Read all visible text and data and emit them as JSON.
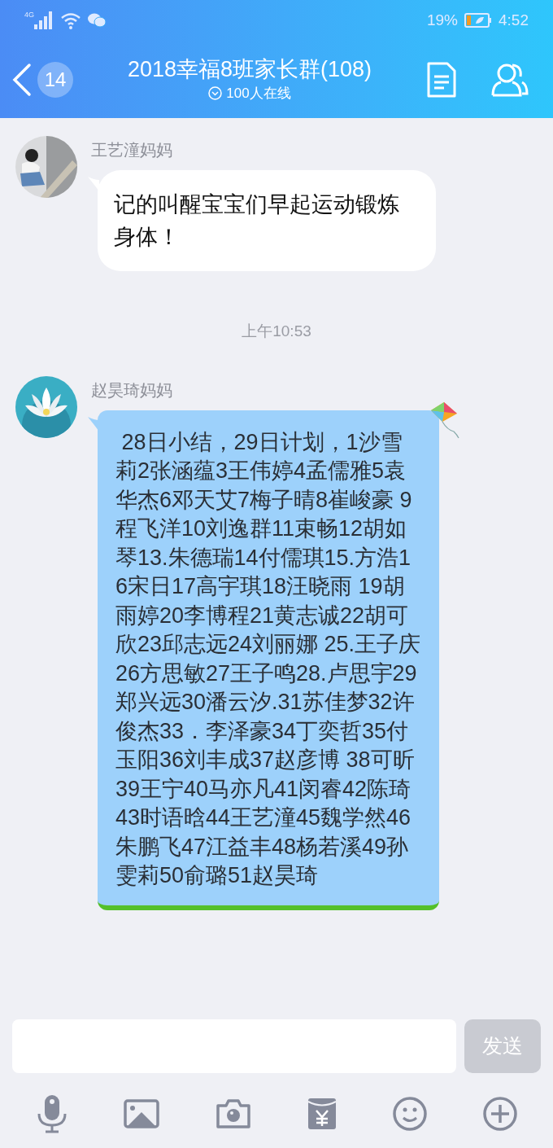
{
  "status_bar": {
    "network": "4G",
    "battery_text": "19%",
    "time": "4:52"
  },
  "header": {
    "back_badge": "14",
    "title": "2018幸福8班家长群(108)",
    "subtitle": "100人在线"
  },
  "messages": [
    {
      "kind": "message",
      "sender": "王艺潼妈妈",
      "text": "记的叫醒宝宝们早起运动锻炼身体！"
    },
    {
      "kind": "time",
      "text": "上午10:53"
    },
    {
      "kind": "themed_message",
      "sender": "赵昊琦妈妈",
      "text": " 28日小结，29日计划，1沙雪莉2张涵蕴3王伟婷4孟儒雅5袁华杰6邓天艾7梅子晴8崔峻豪 9 程飞洋10刘逸群11束畅12胡如琴13.朱德瑞14付儒琪15.方浩16宋日17高宇琪18汪晓雨 19胡雨婷20李博程21黄志诚22胡可欣23邱志远24刘丽娜 25.王子庆26方思敏27王子鸣28.卢思宇29郑兴远30潘云汐.31苏佳梦32许俊杰33．李泽豪34丁奕哲35付玉阳36刘丰成37赵彦博 38可昕39王宁40马亦凡41闵睿42陈琦43时语晗44王艺潼45魏学然46朱鹏飞47江益丰48杨若溪49孙雯莉50俞璐51赵昊琦"
    }
  ],
  "composer": {
    "send_button": {
      "label": "发送",
      "disabled": true
    }
  }
}
